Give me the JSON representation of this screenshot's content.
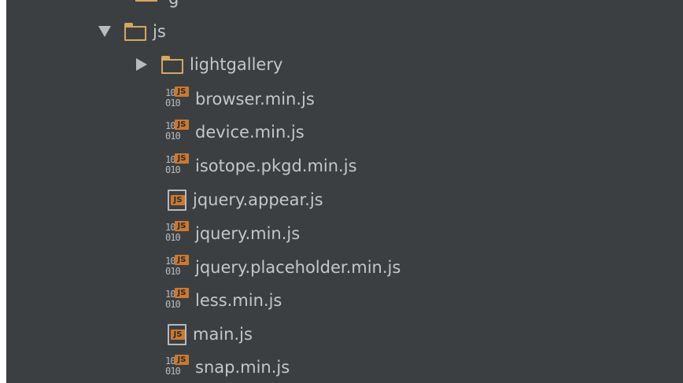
{
  "tree": {
    "partial_item": {
      "label": "g"
    },
    "folder": {
      "name": "js",
      "expanded": true
    },
    "subfolder": {
      "name": "lightgallery",
      "expanded": false
    },
    "files": [
      {
        "name": "browser.min.js",
        "icon": "minified-js-icon"
      },
      {
        "name": "device.min.js",
        "icon": "minified-js-icon"
      },
      {
        "name": "isotope.pkgd.min.js",
        "icon": "minified-js-icon"
      },
      {
        "name": "jquery.appear.js",
        "icon": "js-file-icon"
      },
      {
        "name": "jquery.min.js",
        "icon": "minified-js-icon"
      },
      {
        "name": "jquery.placeholder.min.js",
        "icon": "minified-js-icon"
      },
      {
        "name": "less.min.js",
        "icon": "minified-js-icon"
      },
      {
        "name": "main.js",
        "icon": "js-file-icon"
      },
      {
        "name": "snap.min.js",
        "icon": "minified-js-icon"
      }
    ],
    "icon_texts": {
      "binary_digits": "10\n010",
      "js_badge": "JS"
    },
    "colors": {
      "background": "#3c3f41",
      "text": "#c4c7c9",
      "folder": "#d6a75f",
      "js_badge": "#cc7832",
      "icon_gray": "#b7babc"
    }
  }
}
